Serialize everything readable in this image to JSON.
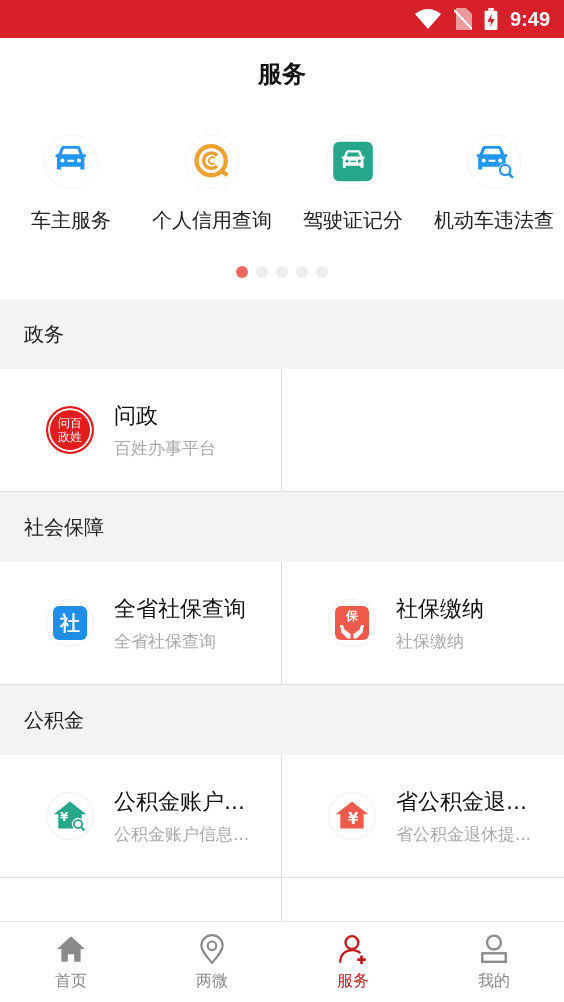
{
  "status_bar": {
    "time": "9:49"
  },
  "header": {
    "title": "服务"
  },
  "shortcuts": [
    {
      "label": "车主服务",
      "kind": "car"
    },
    {
      "label": "个人信用查询",
      "kind": "credit"
    },
    {
      "label": "驾驶证记分",
      "kind": "license"
    },
    {
      "label": "机动车违法查",
      "kind": "car-search"
    }
  ],
  "pager": [
    {
      "selected": true
    },
    {
      "selected": false
    },
    {
      "selected": false
    },
    {
      "selected": false
    },
    {
      "selected": false
    }
  ],
  "sections": [
    {
      "title": "政务",
      "items": [
        {
          "title": "问政",
          "subtitle": "百姓办事平台",
          "kind": "stamp",
          "glyphs": [
            "问",
            "百",
            "政",
            "姓"
          ]
        }
      ]
    },
    {
      "title": "社会保障",
      "items": [
        {
          "title": "全省社保查询",
          "subtitle": "全省社保查询",
          "kind": "square-blue",
          "glyphs": [
            "社"
          ]
        },
        {
          "title": "社保缴纳",
          "subtitle": "社保缴纳",
          "kind": "square-hands",
          "glyphs": [
            "保"
          ]
        }
      ]
    },
    {
      "title": "公积金",
      "items": [
        {
          "title": "公积金账户...",
          "subtitle": "公积金账户信息...",
          "kind": "house-search",
          "glyphs": [
            "¥"
          ]
        },
        {
          "title": "省公积金退...",
          "subtitle": "省公积金退休提...",
          "kind": "house-red",
          "glyphs": [
            "¥"
          ]
        }
      ]
    }
  ],
  "tabs": [
    {
      "label": "首页",
      "kind": "home",
      "selected": false
    },
    {
      "label": "两微",
      "kind": "pin",
      "selected": false
    },
    {
      "label": "服务",
      "kind": "person-add",
      "selected": true
    },
    {
      "label": "我的",
      "kind": "person",
      "selected": false
    }
  ]
}
